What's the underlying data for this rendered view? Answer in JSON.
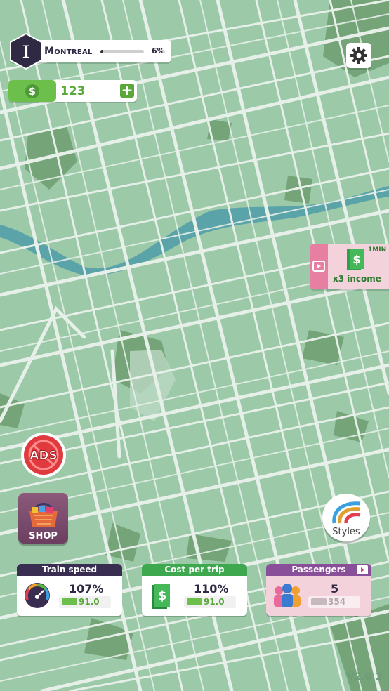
{
  "level": {
    "number": "I",
    "city": "Montreal",
    "progress_percent": 6,
    "progress_text": "6%"
  },
  "money": {
    "value": "123",
    "add_symbol": "+"
  },
  "offer": {
    "duration": "1MIN",
    "label": "x3 income"
  },
  "buttons": {
    "ads": "ADS",
    "shop": "SHOP",
    "styles": "Styles"
  },
  "cards": {
    "train_speed": {
      "title": "Train speed",
      "value": "107%",
      "cost": "91.0"
    },
    "cost_per_trip": {
      "title": "Cost per trip",
      "value": "110%",
      "cost": "91.0"
    },
    "passengers": {
      "title": "Passengers",
      "value": "5",
      "cost": "354"
    }
  },
  "version": "V2.0.2",
  "colors": {
    "map": "#9ccaa9",
    "road": "#e6efe8",
    "park": "#6f9e72",
    "river": "#5aa3a8",
    "accent_green": "#5aa83c",
    "dark": "#2f2944"
  }
}
